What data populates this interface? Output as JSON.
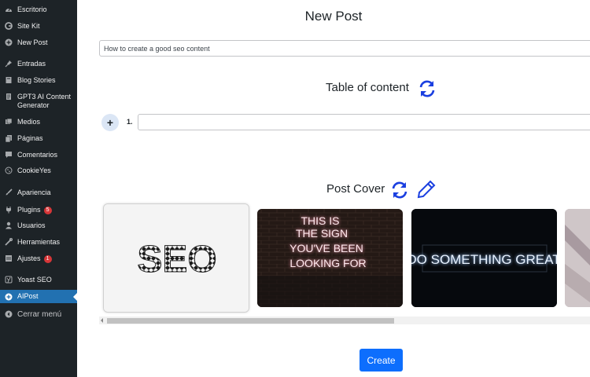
{
  "sidebar": {
    "items": [
      {
        "label": "Escritorio",
        "icon": "dashboard-icon"
      },
      {
        "label": "Site Kit",
        "icon": "google-g-icon"
      },
      {
        "label": "New Post",
        "icon": "plus-circle-icon"
      },
      {
        "label": "Entradas",
        "icon": "pushpin-icon"
      },
      {
        "label": "Blog Stories",
        "icon": "book-icon"
      },
      {
        "label": "GPT3 AI Content Generator",
        "icon": "document-icon"
      },
      {
        "label": "Medios",
        "icon": "media-icon"
      },
      {
        "label": "Páginas",
        "icon": "pages-icon"
      },
      {
        "label": "Comentarios",
        "icon": "comment-icon"
      },
      {
        "label": "CookieYes",
        "icon": "cookie-icon"
      },
      {
        "label": "Apariencia",
        "icon": "paintbrush-icon"
      },
      {
        "label": "Plugins",
        "icon": "plugin-icon",
        "badge": "5"
      },
      {
        "label": "Usuarios",
        "icon": "user-icon"
      },
      {
        "label": "Herramientas",
        "icon": "wrench-icon"
      },
      {
        "label": "Ajustes",
        "icon": "settings-icon",
        "badge": "1"
      },
      {
        "label": "Yoast SEO",
        "icon": "yoast-icon"
      },
      {
        "label": "AIPost",
        "icon": "plus-circle-icon",
        "active": true
      },
      {
        "label": "Cerrar menú",
        "icon": "collapse-icon"
      }
    ],
    "active_color": "#2271b1",
    "background": "#1d2327"
  },
  "main": {
    "page_title": "New Post",
    "title_input_value": "How to create a good seo content",
    "toc": {
      "title": "Table of content",
      "items": [
        {
          "number": "1.",
          "value": ""
        }
      ]
    },
    "cover": {
      "title": "Post Cover",
      "images": [
        {
          "text": "SEO"
        },
        {
          "text": [
            "THIS IS",
            "THE SIGN",
            "YOU'VE BEEN",
            "LOOKING FOR"
          ]
        },
        {
          "text": "DO SOMETHING GREAT"
        },
        {
          "text": ""
        }
      ]
    },
    "create_label": "Create",
    "accent": "#0d6efd",
    "icon_color": "#1a3fe0"
  }
}
